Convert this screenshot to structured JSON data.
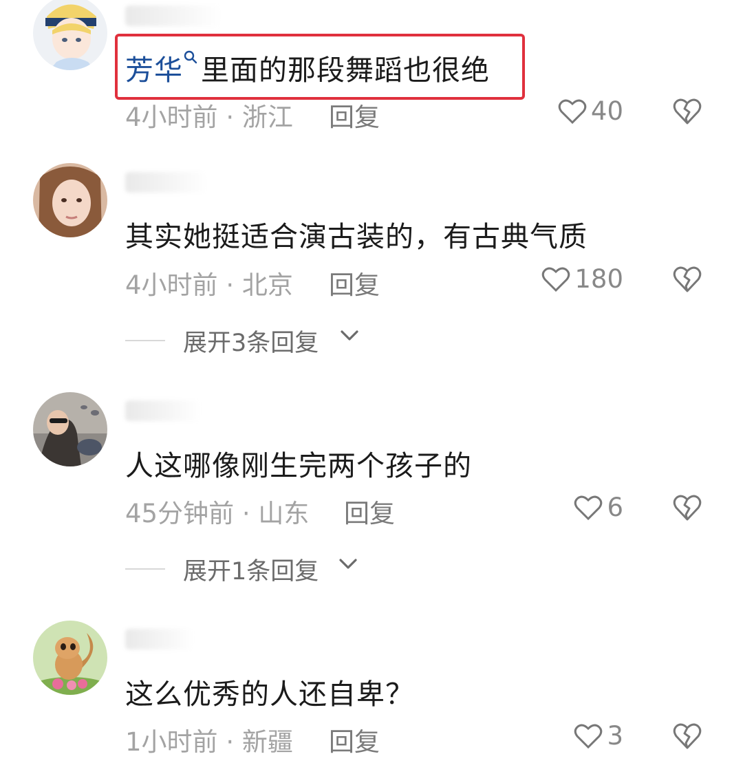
{
  "comments": [
    {
      "mention": "芳华",
      "text": "里面的那段舞蹈也很绝",
      "time": "4小时前",
      "location": "浙江",
      "reply_label": "回复",
      "likes": "40"
    },
    {
      "text": "其实她挺适合演古装的，有古典气质",
      "time": "4小时前",
      "location": "北京",
      "reply_label": "回复",
      "likes": "180",
      "expand_label": "展开3条回复"
    },
    {
      "text": "人这哪像刚生完两个孩子的",
      "time": "45分钟前",
      "location": "山东",
      "reply_label": "回复",
      "likes": "6",
      "expand_label": "展开1条回复"
    },
    {
      "text": "这么优秀的人还自卑？",
      "time": "1小时前",
      "location": "新疆",
      "reply_label": "回复",
      "likes": "3"
    }
  ],
  "separator": "·",
  "icons": {
    "like": "heart-outline-icon",
    "dislike": "broken-heart-icon",
    "expand": "chevron-down-icon",
    "mention": "search-icon"
  },
  "colors": {
    "highlight_border": "#e0303d",
    "mention": "#1c4f9a",
    "meta": "#a3a3a3"
  }
}
